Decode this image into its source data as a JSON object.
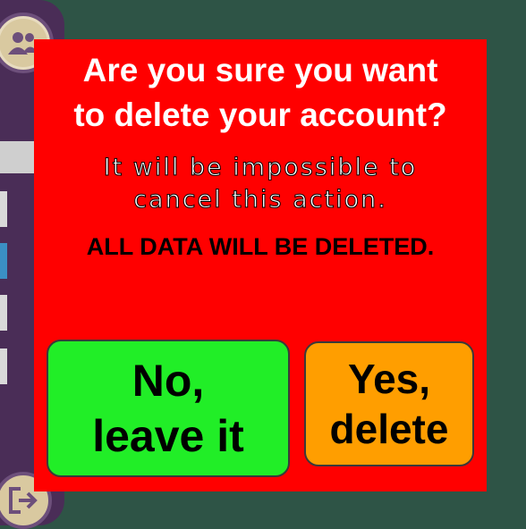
{
  "sidebar": {
    "avatar_icon": "users-icon",
    "exit_icon": "logout-icon"
  },
  "dialog": {
    "title_line1": "Are you sure you want",
    "title_line2": "to delete your account?",
    "subtitle_line1": "It will be impossible to",
    "subtitle_line2": "cancel this action.",
    "warning": "ALL DATA WILL BE DELETED.",
    "cancel_button": {
      "line1": "No,",
      "line2": "leave it",
      "color": "#21ee27"
    },
    "confirm_button": {
      "line1": "Yes,",
      "line2": "delete",
      "color": "#ff9e00"
    },
    "background_color": "#ff0000"
  },
  "colors": {
    "backdrop": "#2e5446",
    "sidebar": "#4a2d57"
  }
}
